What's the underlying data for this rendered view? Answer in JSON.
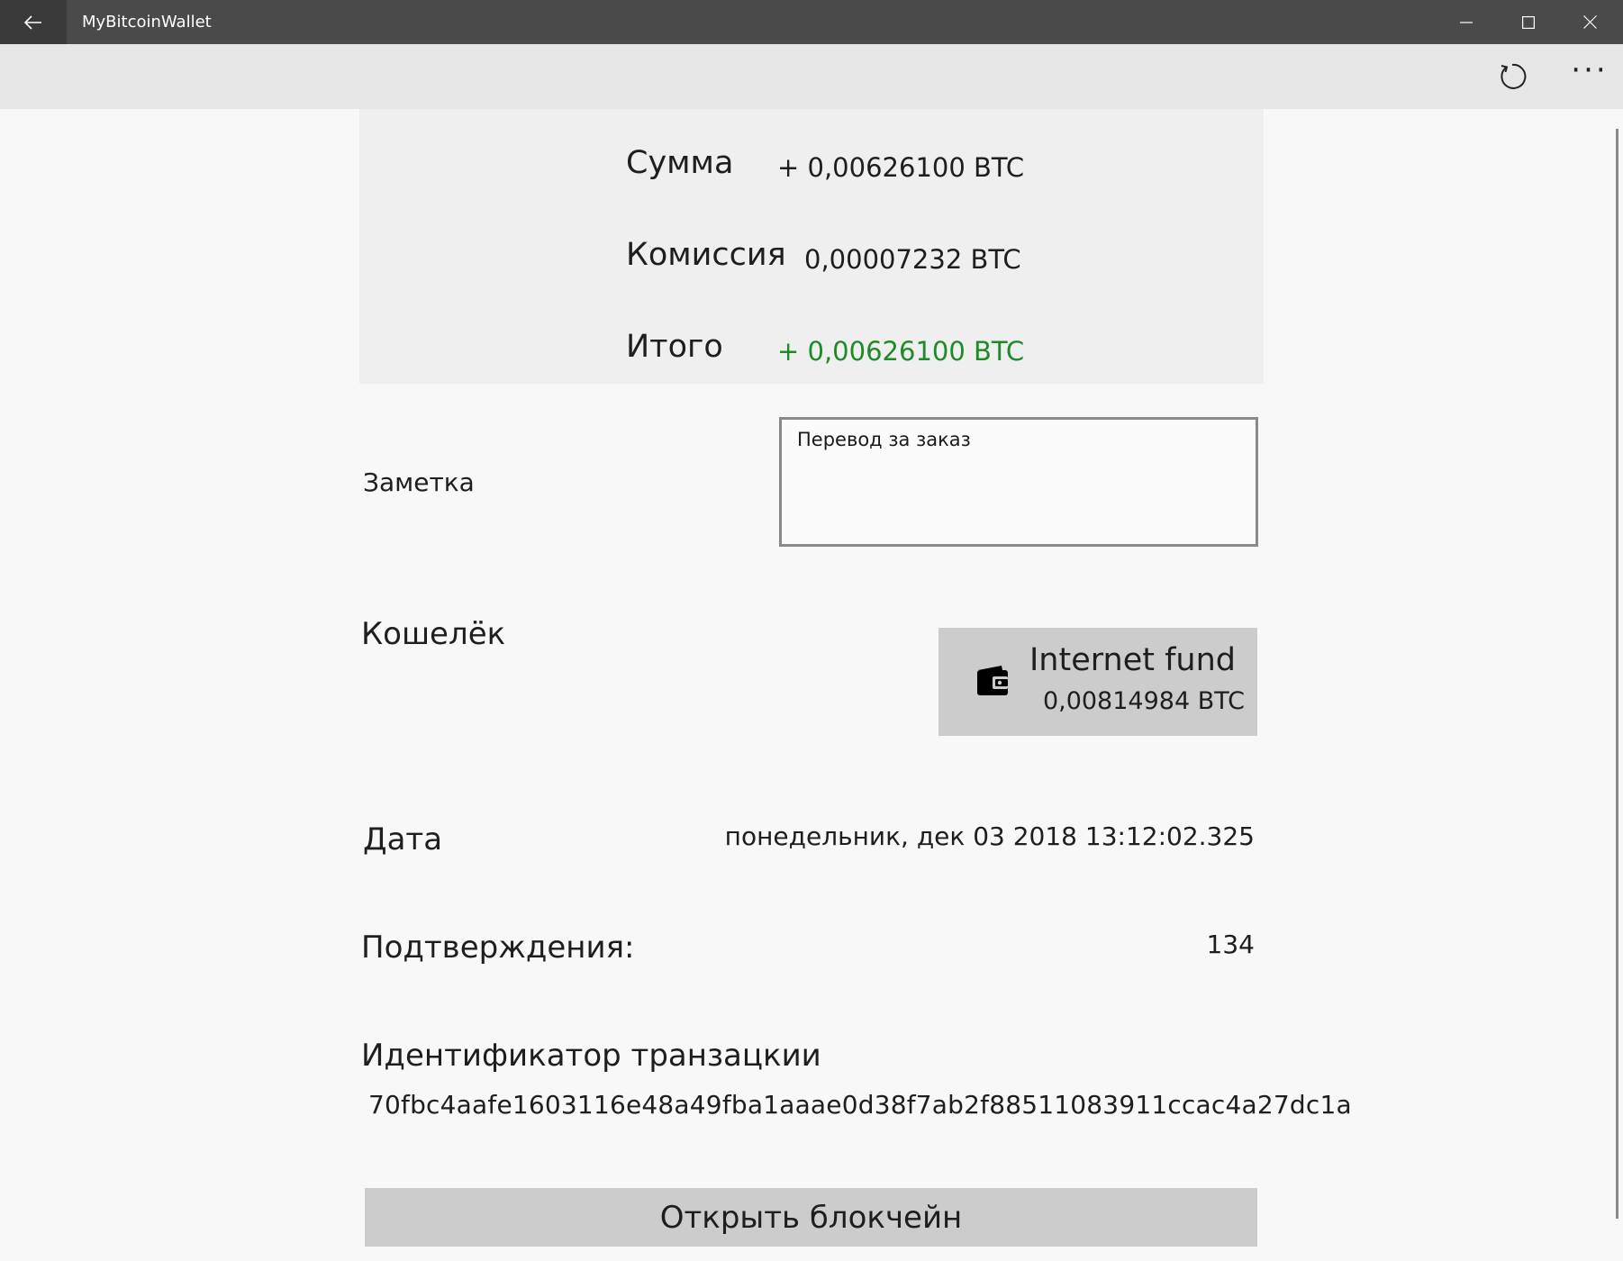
{
  "window": {
    "title": "MyBitcoinWallet",
    "controls": [
      "minimize",
      "maximize",
      "close"
    ]
  },
  "command_bar": {
    "refresh_icon": "refresh-icon",
    "more_label": "···"
  },
  "summary": {
    "amount_label": "Сумма",
    "amount_value": "+ 0,00626100 BTC",
    "fee_label": "Комиссия",
    "fee_value": "0,00007232 BTC",
    "total_label": "Итого",
    "total_value": "+ 0,00626100 BTC",
    "total_color": "#1f8a28"
  },
  "note": {
    "label": "Заметка",
    "value": "Перевод за заказ"
  },
  "wallet": {
    "label": "Кошелёк",
    "name": "Internet fund",
    "balance": "0,00814984 BTC",
    "icon": "wallet-icon"
  },
  "date": {
    "label": "Дата",
    "value": "понедельник, дек 03 2018 13:12:02.325"
  },
  "confirmations": {
    "label": "Подтверждения:",
    "value": "134"
  },
  "transaction": {
    "label": "Идентификатор транзацкии",
    "id": "70fbc4aafe1603116e48a49fba1aaae0d38f7ab2f88511083911ccac4a27dc1a"
  },
  "open_blockchain_label": "Открыть блокчейн"
}
